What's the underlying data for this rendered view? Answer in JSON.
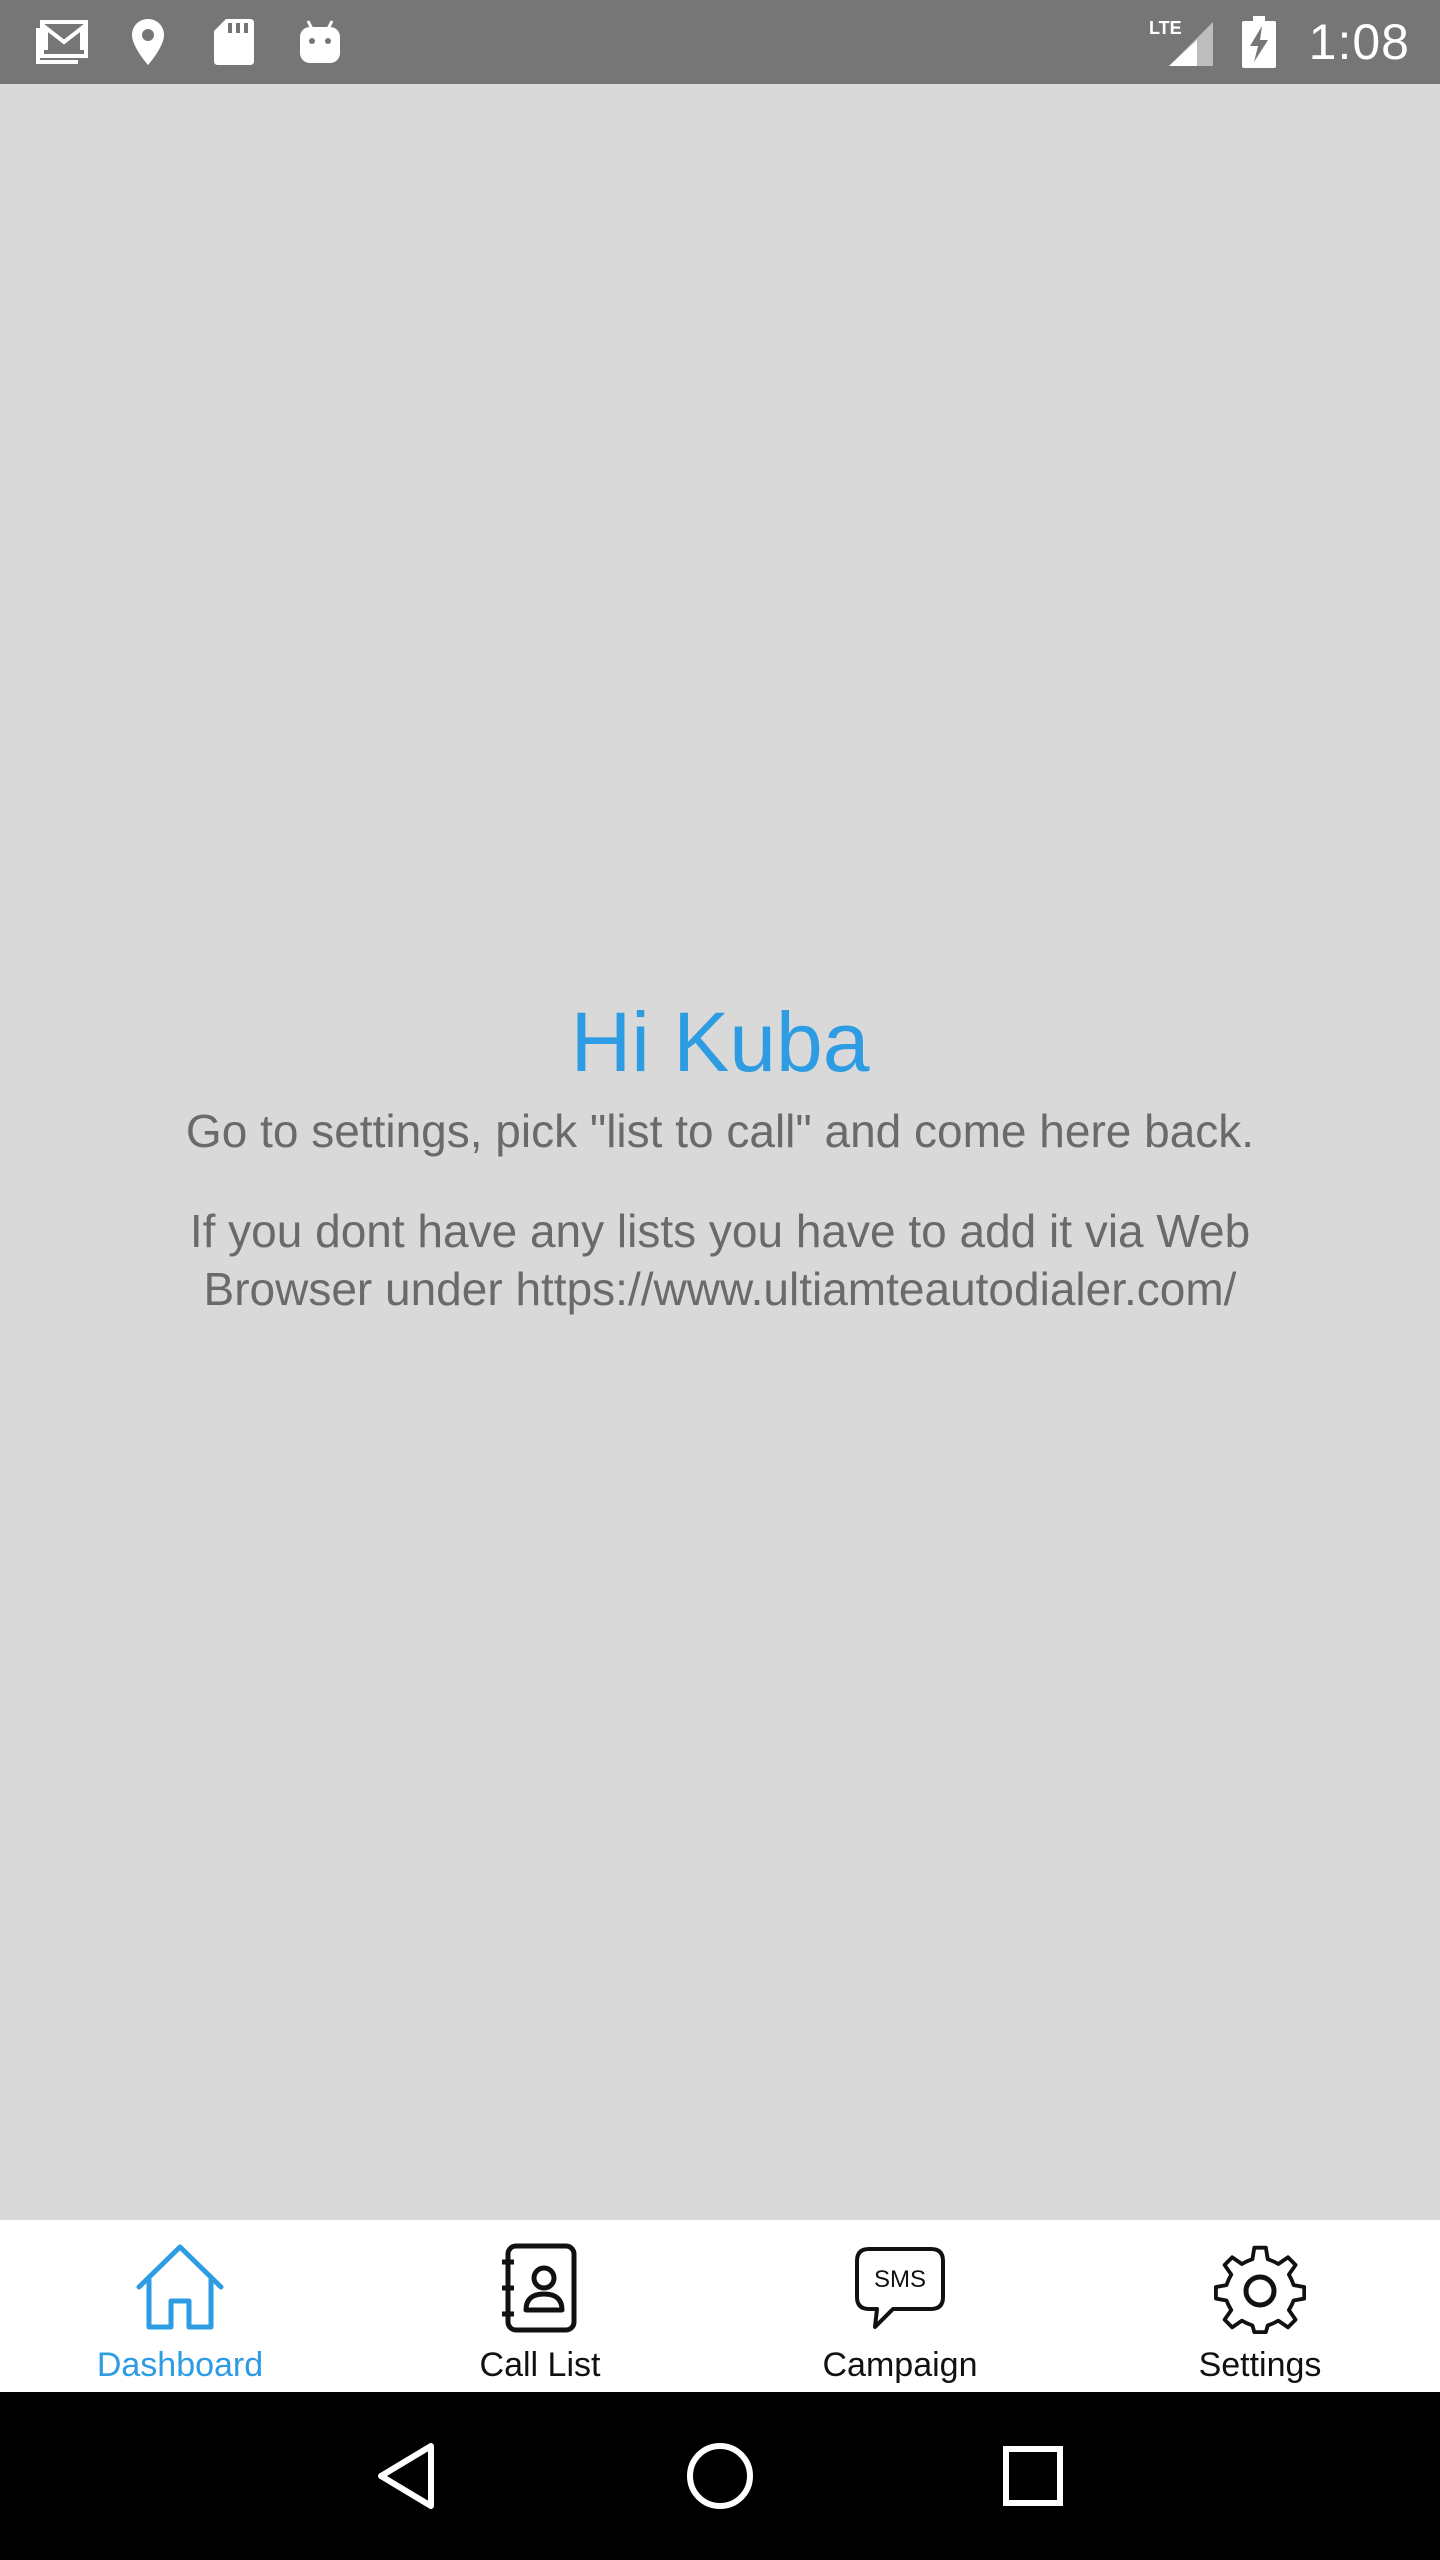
{
  "status_bar": {
    "time": "1:08",
    "network": "LTE",
    "left_icons": [
      "gmail-icon",
      "location-icon",
      "sd-card-icon",
      "android-icon"
    ],
    "right_icons": [
      "lte-signal-icon",
      "battery-charging-icon"
    ]
  },
  "main": {
    "greeting": "Hi Kuba",
    "instruction": "Go to settings, pick \"list to call\" and come here back.",
    "info": "If you dont have any lists you have to add it via Web Browser under https://www.ultiamteautodialer.com/"
  },
  "bottom_nav": {
    "items": [
      {
        "label": "Dashboard",
        "icon": "home-icon",
        "active": true
      },
      {
        "label": "Call List",
        "icon": "contacts-book-icon",
        "active": false
      },
      {
        "label": "Campaign",
        "icon": "sms-bubble-icon",
        "sms_text": "SMS",
        "active": false
      },
      {
        "label": "Settings",
        "icon": "gear-icon",
        "active": false
      }
    ]
  },
  "colors": {
    "accent": "#2d9ce3",
    "background": "#d9d9d9",
    "status_bar": "#767676",
    "body_text": "#6a6a6a"
  },
  "system_nav": {
    "buttons": [
      "back-icon",
      "home-circle-icon",
      "recents-icon"
    ]
  }
}
